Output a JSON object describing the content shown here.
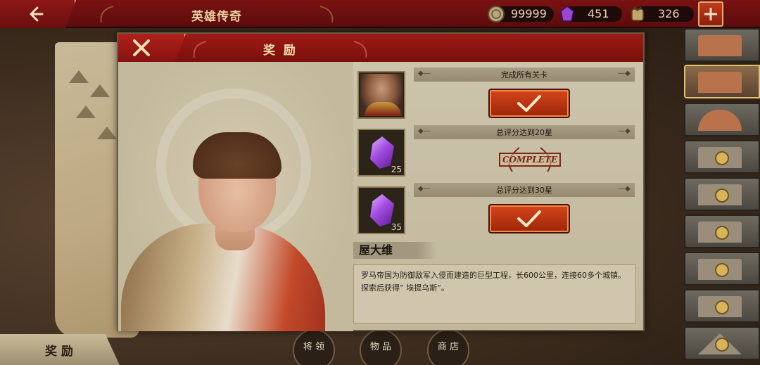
{
  "topbar": {
    "title": "英雄传奇",
    "coins": "99999",
    "gems": "451",
    "medals": "326"
  },
  "dialog": {
    "title": "奖 励",
    "rewards": [
      {
        "condition": "完成所有关卡",
        "item": "hero-portrait",
        "qty": "",
        "state": "claimable"
      },
      {
        "condition": "总评分达到20星",
        "item": "purple-crystal",
        "qty": "25",
        "state": "complete",
        "stamp": "COMPLETE"
      },
      {
        "condition": "总评分达到30星",
        "item": "purple-crystal",
        "qty": "35",
        "state": "claimable"
      }
    ],
    "hero_name": "屋大维",
    "description": "罗马帝国为防御敌军入侵而建造的巨型工程，长600公里，连接60多个城镇。探索后获得” 埃提乌斯”。"
  },
  "bottom": {
    "reward_tab": "奖 励",
    "nav": [
      "将 领",
      "物 品",
      "商 店"
    ]
  },
  "buildings": [
    {
      "name": "building-1",
      "locked": false,
      "active": false
    },
    {
      "name": "building-2",
      "locked": false,
      "active": true
    },
    {
      "name": "building-3",
      "locked": false,
      "active": false
    },
    {
      "name": "building-4",
      "locked": true,
      "active": false
    },
    {
      "name": "building-5",
      "locked": true,
      "active": false
    },
    {
      "name": "building-6",
      "locked": true,
      "active": false
    },
    {
      "name": "building-7",
      "locked": true,
      "active": false
    },
    {
      "name": "building-8",
      "locked": true,
      "active": false
    },
    {
      "name": "building-9",
      "locked": true,
      "active": false
    }
  ],
  "colors": {
    "accent_red": "#7a1212",
    "gold": "#d9b46b",
    "button_orange": "#d5461c"
  }
}
